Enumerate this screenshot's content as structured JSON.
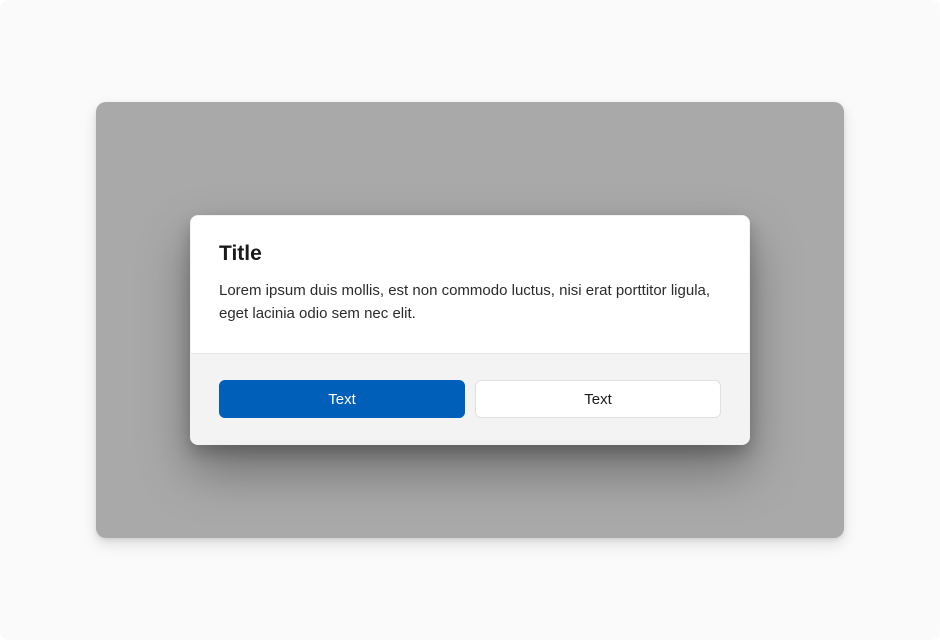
{
  "dialog": {
    "title": "Title",
    "content": "Lorem ipsum duis mollis, est non commodo luctus, nisi erat porttitor ligula, eget lacinia odio sem nec elit.",
    "primary_button_label": "Text",
    "secondary_button_label": "Text"
  },
  "colors": {
    "accent": "#005fb8",
    "overlay": "#a9a9a9",
    "footer_bg": "#f3f3f3"
  }
}
